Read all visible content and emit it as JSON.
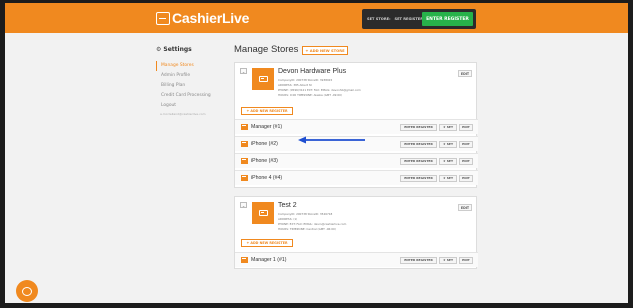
{
  "header": {
    "logo_text": "CashierLive",
    "store_label": "SET STORE:",
    "register_label": "SET REGISTER:",
    "enter_register_label": "ENTER REGISTER"
  },
  "sidebar": {
    "title": "Settings",
    "items": [
      {
        "label": "Manage Stores",
        "active": true
      },
      {
        "label": "Admin Profile",
        "active": false
      },
      {
        "label": "Billing Plan",
        "active": false
      },
      {
        "label": "Credit Card Processing",
        "active": false
      },
      {
        "label": "Logout",
        "active": false
      }
    ],
    "email": "a.mcclelland@cashierlive.com"
  },
  "main": {
    "title": "Manage Stores",
    "add_store_label": "+ ADD NEW STORE"
  },
  "stores": [
    {
      "name": "Devon Hardware Plus",
      "ids": "CompanyID: 290738  StoreID: 3938915",
      "address": "ADDRESS: 385 Albert St",
      "contact": "PHONE: (0596)3121  EXT:  FAX:  EMAIL: devonhb@gmail.com",
      "hours": "HOURS: 9:00  TIMEZONE: Alaska (GMT -09:00)",
      "edit_label": "EDIT",
      "add_register_label": "+ ADD NEW REGISTER",
      "registers": [
        {
          "name": "Manager (#1)"
        },
        {
          "name": "iPhone (#2)"
        },
        {
          "name": "iPhone (#3)"
        },
        {
          "name": "iPhone 4 (#4)"
        }
      ]
    },
    {
      "name": "Test 2",
      "ids": "CompanyID: 290738  StoreID: 3526718",
      "address": "ADDRESS: (1)",
      "contact": "PHONE:  EXT:  FAX:  EMAIL: devin@cashierlive.com",
      "hours": "HOURS:  TIMEZONE: Central (GMT -06:00)",
      "edit_label": "EDIT",
      "add_register_label": "+ ADD NEW REGISTER",
      "registers": [
        {
          "name": "Manager 1 (#1)"
        }
      ]
    }
  ],
  "row_buttons": {
    "enter": "ENTER REGISTER",
    "set": "★ SET",
    "edit": "EDIT"
  },
  "colors": {
    "brand_orange": "#f0891f",
    "enter_green": "#27b24a",
    "arrow_blue": "#1f4fd1"
  }
}
